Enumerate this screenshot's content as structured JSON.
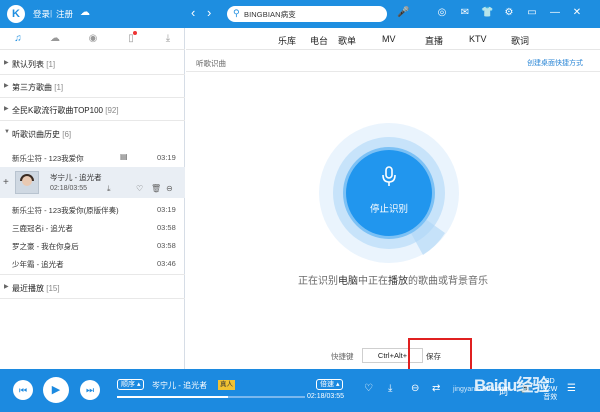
{
  "titlebar": {
    "logo_letter": "K",
    "login": "登录",
    "separator": "|",
    "register": "注册",
    "search_value": "BINGBIAN病变"
  },
  "sidebar": {
    "sections": [
      {
        "label": "默认列表",
        "count": "[1]"
      },
      {
        "label": "第三方歌曲",
        "count": "[1]"
      },
      {
        "label": "全民K歌流行歌曲TOP100",
        "count": "[92]"
      },
      {
        "label": "听歌识曲历史",
        "count": "[6]"
      }
    ],
    "songs_before": [
      {
        "title": "新乐尘符 - 123我爱你",
        "duration": "03:19"
      }
    ],
    "current": {
      "title": "岑宁儿 - 追光者",
      "time": "02:18/03:55"
    },
    "songs_after": [
      {
        "title": "新乐尘符 - 123我爱你(原版伴奏)",
        "duration": "03:19"
      },
      {
        "title": "三鹿冠名i - 追光者",
        "duration": "03:58"
      },
      {
        "title": "罗之豪 - 我在你身后",
        "duration": "03:58"
      },
      {
        "title": "少年霜 - 追光者",
        "duration": "03:46"
      }
    ],
    "recent": {
      "label": "最近播放",
      "count": "[15]"
    }
  },
  "main": {
    "tabs": [
      "乐库",
      "电台",
      "歌单",
      "MV",
      "直播",
      "KTV",
      "歌词"
    ],
    "crumb": "听歌识曲",
    "shortcut_link": "创建桌面快捷方式",
    "stop_label": "停止识别",
    "status_pre": "正在识别",
    "status_hl1": "电脑",
    "status_mid": "中正在",
    "status_hl2": "播放",
    "status_post": "的歌曲或背景音乐",
    "hotkey_label": "快捷键",
    "hotkey_value": "Ctrl+Alt+",
    "save_label": "保存"
  },
  "player": {
    "mode": "顺序 ▴",
    "title": "岑宁儿 - 追光者",
    "badge": "真人",
    "speed": "倍速 ▴",
    "time": "02:18/03:55",
    "progress": 0.59,
    "quality_top": "3D",
    "quality_mid": "32W",
    "quality_bot": "音效"
  },
  "watermark": {
    "brand": "Baidu经验",
    "url": "jingyan.baidu.com"
  },
  "colors": {
    "accent": "#1e8ee0",
    "highlight_box": "#e02020"
  }
}
